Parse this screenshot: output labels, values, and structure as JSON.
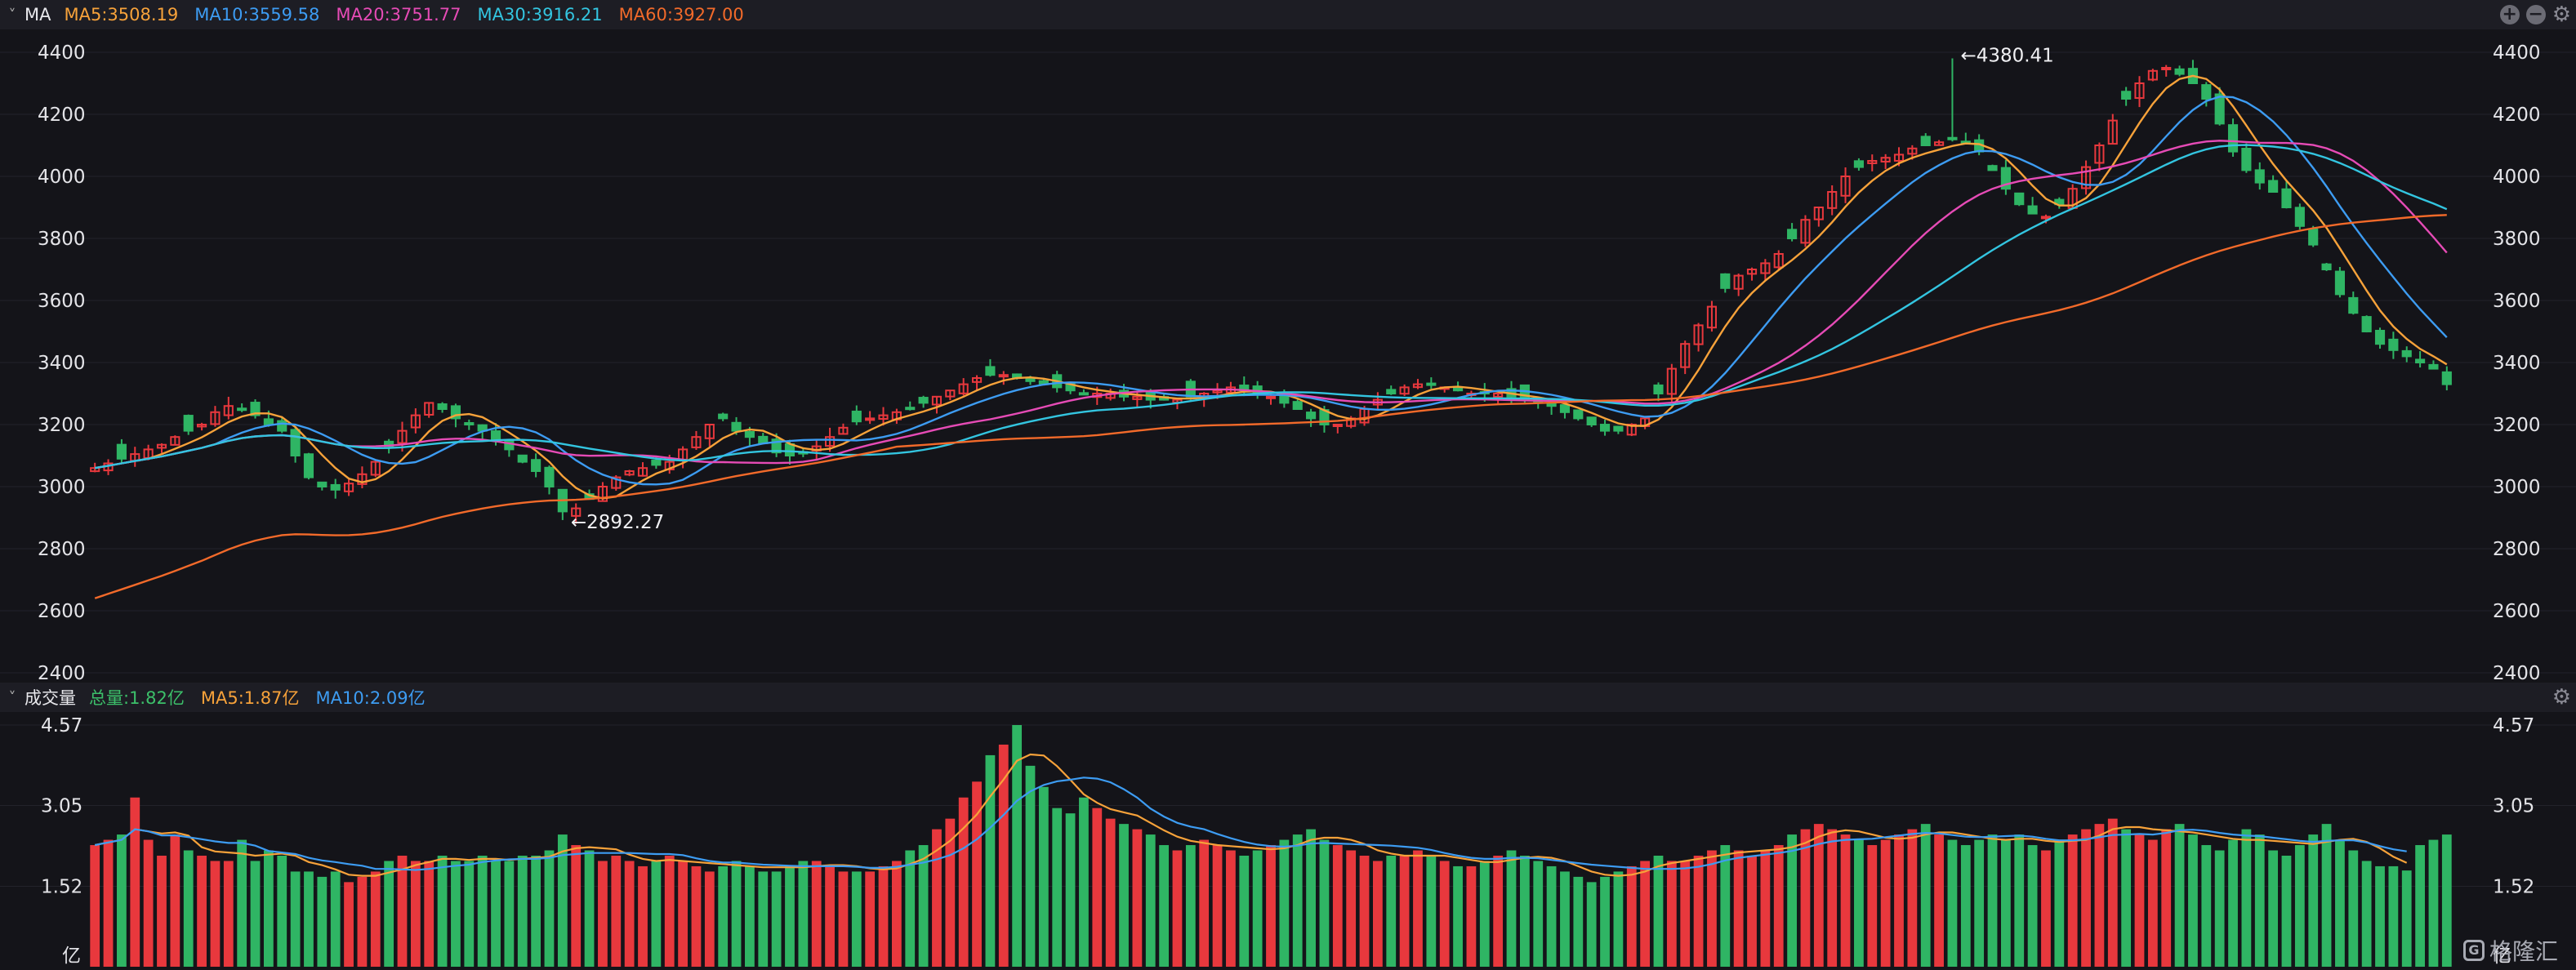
{
  "price_header": {
    "toggle": "˅",
    "title": "MA",
    "items": [
      {
        "label": "MA5:3508.19",
        "color": "#f7a23a"
      },
      {
        "label": "MA10:3559.58",
        "color": "#3d9cf2"
      },
      {
        "label": "MA20:3751.77",
        "color": "#e64bb6"
      },
      {
        "label": "MA30:3916.21",
        "color": "#33c5e0"
      },
      {
        "label": "MA60:3927.00",
        "color": "#f26a2a"
      }
    ],
    "buttons": [
      "add-icon",
      "remove-icon",
      "gear-icon"
    ]
  },
  "volume_header": {
    "toggle": "˅",
    "title": "成交量",
    "items": [
      {
        "label": "总量:1.82亿",
        "color": "#3cc06a"
      },
      {
        "label": "MA5:1.87亿",
        "color": "#f7a23a"
      },
      {
        "label": "MA10:2.09亿",
        "color": "#3d9cf2"
      }
    ],
    "buttons": [
      "gear-icon"
    ]
  },
  "watermark": {
    "text": "格隆汇",
    "logo": "G"
  },
  "chart_data": [
    {
      "type": "candlestick",
      "y_ticks": [
        "4400",
        "4200",
        "4000",
        "3800",
        "3600",
        "3400",
        "3200",
        "3000",
        "2800",
        "2600",
        "2400"
      ],
      "ylim": [
        2400,
        4400
      ],
      "annotations": [
        {
          "label": "←4380.41",
          "index": 139,
          "value": 4380.41
        },
        {
          "label": "←2892.27",
          "index": 35,
          "value": 2892.27
        }
      ],
      "colors": {
        "up": "#e8383d",
        "down": "#2fb564"
      },
      "series": [
        {
          "name": "MA5",
          "color": "#f7a23a"
        },
        {
          "name": "MA10",
          "color": "#3d9cf2"
        },
        {
          "name": "MA20",
          "color": "#e64bb6"
        },
        {
          "name": "MA30",
          "color": "#33c5e0"
        },
        {
          "name": "MA60",
          "color": "#f26a2a"
        }
      ],
      "close": [
        3060,
        3075,
        3090,
        3105,
        3120,
        3135,
        3160,
        3180,
        3200,
        3240,
        3260,
        3250,
        3230,
        3200,
        3180,
        3100,
        3030,
        3000,
        2990,
        3010,
        3040,
        3080,
        3130,
        3180,
        3230,
        3270,
        3250,
        3220,
        3200,
        3180,
        3150,
        3120,
        3080,
        3050,
        3000,
        2920,
        2930,
        2960,
        3000,
        3030,
        3050,
        3060,
        3070,
        3080,
        3120,
        3160,
        3200,
        3220,
        3180,
        3160,
        3140,
        3110,
        3100,
        3110,
        3130,
        3160,
        3190,
        3210,
        3220,
        3230,
        3240,
        3250,
        3270,
        3290,
        3310,
        3330,
        3350,
        3360,
        3360,
        3350,
        3340,
        3330,
        3320,
        3310,
        3300,
        3300,
        3300,
        3290,
        3290,
        3280,
        3280,
        3280,
        3290,
        3300,
        3310,
        3320,
        3310,
        3300,
        3290,
        3270,
        3250,
        3220,
        3200,
        3200,
        3220,
        3250,
        3280,
        3300,
        3320,
        3330,
        3330,
        3320,
        3310,
        3300,
        3300,
        3300,
        3290,
        3280,
        3270,
        3260,
        3240,
        3220,
        3200,
        3180,
        3180,
        3200,
        3220,
        3300,
        3380,
        3460,
        3520,
        3580,
        3640,
        3680,
        3700,
        3720,
        3750,
        3800,
        3860,
        3900,
        3950,
        4000,
        4030,
        4050,
        4060,
        4070,
        4090,
        4100,
        4110,
        4120,
        4110,
        4080,
        4020,
        3960,
        3910,
        3880,
        3870,
        3910,
        3960,
        4030,
        4100,
        4180,
        4250,
        4300,
        4340,
        4350,
        4330,
        4300,
        4250,
        4170,
        4080,
        4020,
        3980,
        3950,
        3900,
        3840,
        3780,
        3700,
        3620,
        3560,
        3500,
        3460,
        3440,
        3420,
        3400,
        3380,
        3330
      ],
      "ohlc_seed": 7
    },
    {
      "type": "bar",
      "y_ticks": [
        "4.57",
        "3.05",
        "1.52"
      ],
      "ylim": [
        0,
        4.57
      ],
      "unit": "亿",
      "series": [
        {
          "name": "MA5",
          "color": "#f7a23a"
        },
        {
          "name": "MA10",
          "color": "#3d9cf2"
        }
      ],
      "volume_base": [
        2.3,
        2.4,
        2.5,
        3.2,
        2.4,
        2.1,
        2.5,
        2.2,
        2.1,
        2.0,
        2.0,
        2.4,
        2.0,
        2.2,
        2.1,
        1.8,
        1.8,
        1.7,
        1.8,
        1.6,
        1.7,
        1.8,
        2.0,
        2.1,
        2.0,
        2.0,
        2.1,
        2.0,
        2.0,
        2.1,
        2.0,
        2.0,
        2.1,
        2.1,
        2.2,
        2.5,
        2.3,
        2.2,
        2.0,
        2.1,
        2.0,
        1.9,
        2.0,
        2.1,
        2.0,
        1.9,
        1.8,
        1.9,
        2.0,
        1.9,
        1.8,
        1.8,
        1.9,
        2.0,
        2.0,
        1.9,
        1.8,
        1.8,
        1.8,
        1.9,
        2.0,
        2.2,
        2.3,
        2.6,
        2.8,
        3.2,
        3.5,
        4.0,
        4.2,
        4.57,
        3.8,
        3.4,
        3.0,
        2.9,
        3.2,
        3.0,
        2.8,
        2.7,
        2.6,
        2.5,
        2.3,
        2.2,
        2.3,
        2.4,
        2.3,
        2.2,
        2.1,
        2.2,
        2.3,
        2.4,
        2.5,
        2.6,
        2.4,
        2.3,
        2.2,
        2.1,
        2.0,
        2.1,
        2.1,
        2.2,
        2.1,
        2.0,
        1.9,
        1.9,
        2.0,
        2.1,
        2.2,
        2.1,
        2.0,
        1.9,
        1.8,
        1.7,
        1.6,
        1.7,
        1.8,
        1.9,
        2.0,
        2.1,
        2.0,
        2.0,
        2.1,
        2.2,
        2.3,
        2.2,
        2.1,
        2.2,
        2.3,
        2.5,
        2.6,
        2.7,
        2.6,
        2.5,
        2.4,
        2.3,
        2.4,
        2.5,
        2.6,
        2.7,
        2.5,
        2.4,
        2.3,
        2.4,
        2.5,
        2.4,
        2.5,
        2.3,
        2.2,
        2.4,
        2.5,
        2.6,
        2.7,
        2.8,
        2.6,
        2.5,
        2.4,
        2.6,
        2.7,
        2.5,
        2.3,
        2.2,
        2.4,
        2.6,
        2.5,
        2.2,
        2.1,
        2.3,
        2.5,
        2.7,
        2.4,
        2.2,
        2.0,
        1.9,
        1.9,
        1.82
      ]
    }
  ]
}
